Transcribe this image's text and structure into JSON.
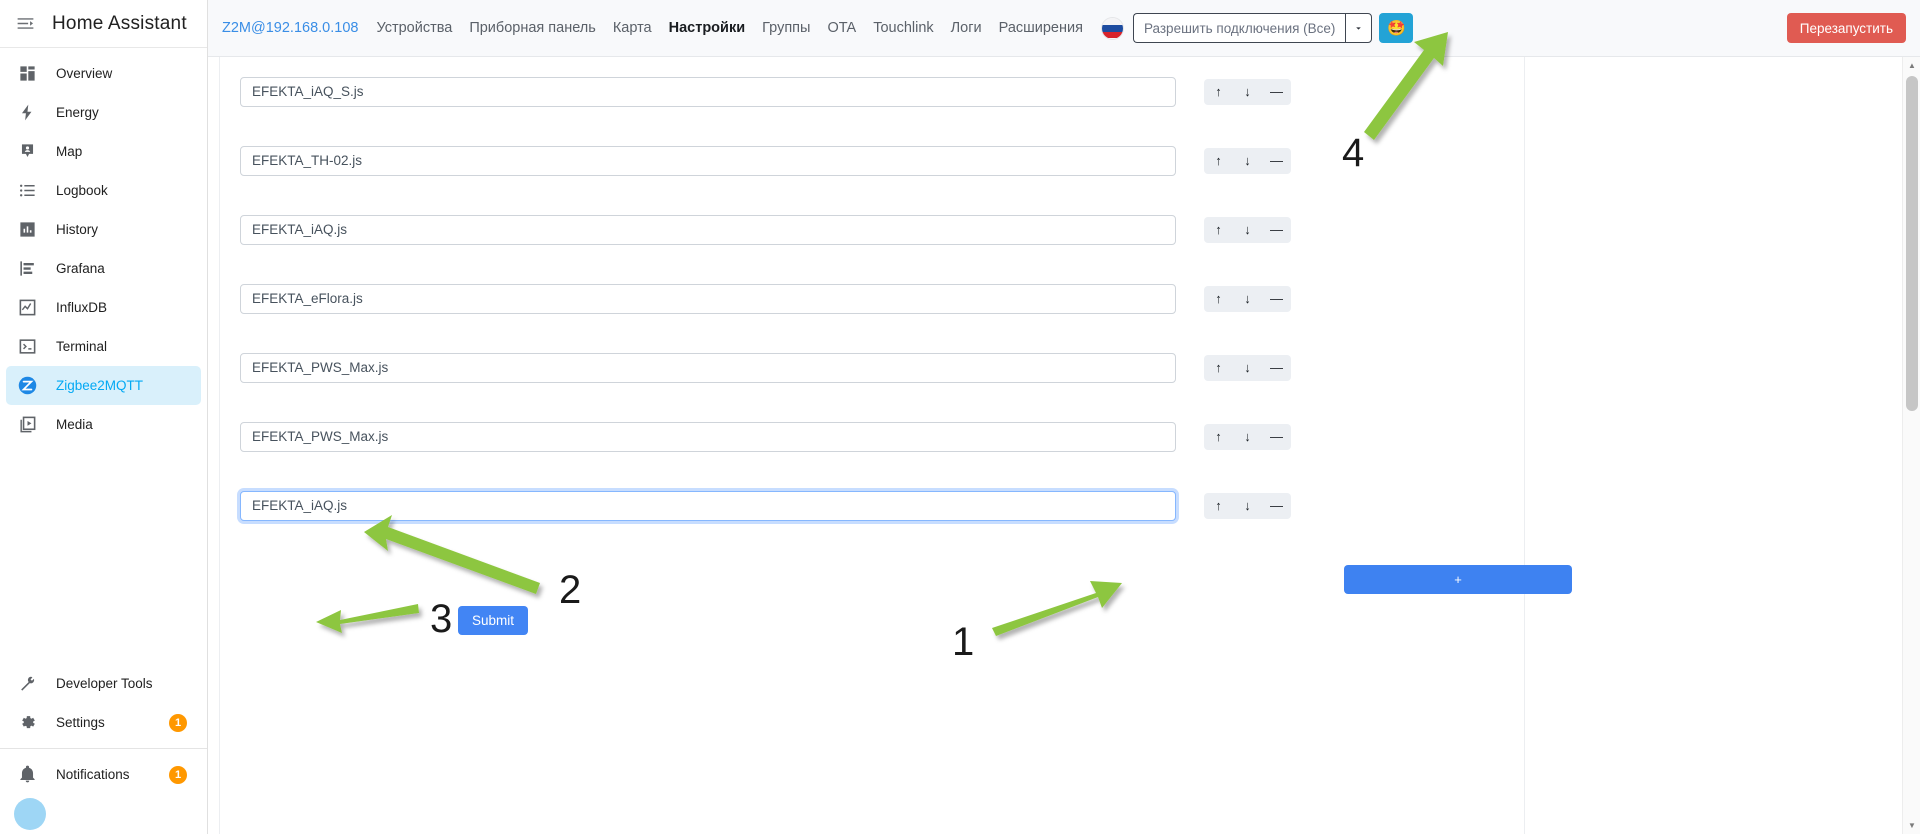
{
  "sidebar": {
    "title": "Home Assistant",
    "toggle_icon": "menu-collapse-icon",
    "items": [
      {
        "label": "Overview",
        "icon": "dashboard-icon",
        "active": false
      },
      {
        "label": "Energy",
        "icon": "lightning-bolt-icon",
        "active": false
      },
      {
        "label": "Map",
        "icon": "map-marker-account-icon",
        "active": false
      },
      {
        "label": "Logbook",
        "icon": "format-list-bulleted-icon",
        "active": false
      },
      {
        "label": "History",
        "icon": "chart-box-icon",
        "active": false
      },
      {
        "label": "Grafana",
        "icon": "chart-bar-stacked-icon",
        "active": false
      },
      {
        "label": "InfluxDB",
        "icon": "chart-line-icon",
        "active": false
      },
      {
        "label": "Terminal",
        "icon": "console-icon",
        "active": false
      },
      {
        "label": "Zigbee2MQTT",
        "icon": "zigbee2mqtt-icon",
        "active": true
      },
      {
        "label": "Media",
        "icon": "play-box-multiple-icon",
        "active": false
      }
    ],
    "bottom_items": [
      {
        "label": "Developer Tools",
        "icon": "hammer-wrench-icon",
        "badge": ""
      },
      {
        "label": "Settings",
        "icon": "cog-icon",
        "badge": "1"
      }
    ],
    "notifications": {
      "label": "Notifications",
      "icon": "bell-icon",
      "badge": "1"
    },
    "avatar": "user-avatar"
  },
  "topbar": {
    "brand": "Z2M@192.168.0.108",
    "tabs": [
      {
        "label": "Устройства",
        "active": false
      },
      {
        "label": "Приборная панель",
        "active": false
      },
      {
        "label": "Карта",
        "active": false
      },
      {
        "label": "Настройки",
        "active": true
      },
      {
        "label": "Группы",
        "active": false
      },
      {
        "label": "OTA",
        "active": false
      },
      {
        "label": "Touchlink",
        "active": false
      },
      {
        "label": "Логи",
        "active": false
      },
      {
        "label": "Расширения",
        "active": false
      }
    ],
    "flag_icon": "russia-flag-icon",
    "permit_join": {
      "value": "Разрешить подключения (Все)",
      "caret_icon": "chevron-down-icon"
    },
    "emoji_button": "🤩",
    "restart_label": "Перезапустить"
  },
  "main": {
    "rows": [
      {
        "value": "EFEKTA_iAQ_S.js",
        "focused": false
      },
      {
        "value": "EFEKTA_TH-02.js",
        "focused": false
      },
      {
        "value": "EFEKTA_iAQ.js",
        "focused": false
      },
      {
        "value": "EFEKTA_eFlora.js",
        "focused": false
      },
      {
        "value": "EFEKTA_PWS_Max.js",
        "focused": false
      },
      {
        "value": "EFEKTA_PWS_Max.js",
        "focused": false
      },
      {
        "value": "EFEKTA_iAQ.js",
        "focused": true
      }
    ],
    "row_controls": {
      "up_icon": "arrow-up-icon",
      "up_glyph": "↑",
      "down_icon": "arrow-down-icon",
      "down_glyph": "↓",
      "remove_icon": "minus-icon",
      "remove_glyph": "—"
    },
    "add_button_label": "+",
    "submit_button_label": "Submit"
  },
  "scrollbar": {
    "up_glyph": "▲",
    "down_glyph": "▼"
  },
  "annotations": [
    {
      "number": "1"
    },
    {
      "number": "2"
    },
    {
      "number": "3"
    },
    {
      "number": "4"
    }
  ],
  "colors": {
    "accent_blue": "#4285f4",
    "active_sidebar": "#03a9f4",
    "restart_red": "#e05b52",
    "badge_orange": "#ff9800",
    "annotation_green": "#8dc63f",
    "emoji_button_blue": "#23a3d6"
  }
}
